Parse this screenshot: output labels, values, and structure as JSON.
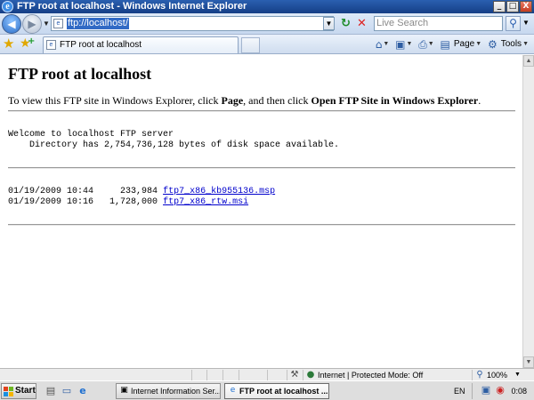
{
  "window": {
    "title": "FTP root at localhost - Windows Internet Explorer",
    "controls": {
      "minimize": "_",
      "maximize": "□",
      "close": "X"
    }
  },
  "address_bar": {
    "url": "ftp://localhost/",
    "search_placeholder": "Live Search"
  },
  "tab": {
    "label": "FTP root at localhost"
  },
  "commands": {
    "page_label": "Page",
    "tools_label": "Tools"
  },
  "page": {
    "heading": "FTP root at localhost",
    "intro_prefix": "To view this FTP site in Windows Explorer, click ",
    "intro_page": "Page",
    "intro_middle": ", and then click ",
    "intro_open": "Open FTP Site in Windows Explorer",
    "intro_suffix": ".",
    "welcome_line": "Welcome to localhost FTP server",
    "directory_line": "Directory has 2,754,736,128 bytes of disk space available.",
    "files": [
      {
        "date": "01/19/2009",
        "time": "10:44",
        "size": "233,984",
        "name": "ftp7_x86_kb955136.msp"
      },
      {
        "date": "01/19/2009",
        "time": "10:16",
        "size": "1,728,000",
        "name": "ftp7_x86_rtw.msi"
      }
    ]
  },
  "status_bar": {
    "zone": "Internet | Protected Mode: Off",
    "zoom": "100%"
  },
  "taskbar": {
    "start_label": "Start",
    "buttons": [
      {
        "label": "Internet Information Ser..."
      },
      {
        "label": "FTP root at localhost ..."
      }
    ],
    "language": "EN",
    "clock": "0:08"
  }
}
